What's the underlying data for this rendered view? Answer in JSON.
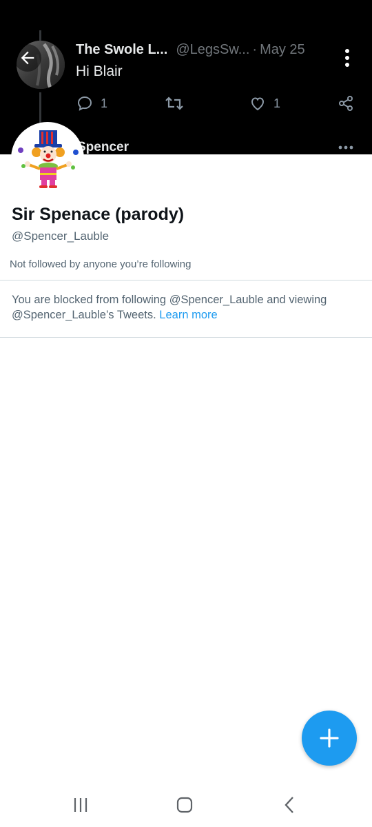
{
  "banner_tweet": {
    "author": "The Swole L...",
    "handle": "@LegsSw...",
    "separator": "·",
    "date": "May 25",
    "text": "Hi Blair",
    "reply_count": "1",
    "like_count": "1"
  },
  "next_tweet": {
    "author_partial": "Spencer"
  },
  "profile": {
    "name": "Sir Spenace (parodу)",
    "handle": "@Spencer_Lauble",
    "followed_by": "Not followed by anyone you’re following"
  },
  "blocked": {
    "message": "You are blocked from following @Spencer_Lauble and viewing @Spencer_Lauble’s Tweets.",
    "link": "Learn more"
  },
  "colors": {
    "accent": "#1d9bf0",
    "banner": "#000000",
    "secondary_text": "#536471"
  },
  "icons": {
    "back": "arrow-left-icon",
    "more": "more-vertical-icon",
    "reply": "reply-icon",
    "retweet": "retweet-icon",
    "like": "heart-icon",
    "share": "share-icon",
    "fab": "plus-icon",
    "nav_recents": "recents-icon",
    "nav_home": "home-icon",
    "nav_back": "back-icon"
  }
}
